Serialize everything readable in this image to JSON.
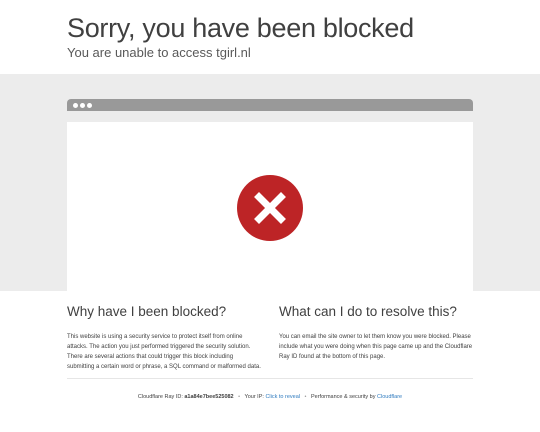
{
  "header": {
    "title": "Sorry, you have been blocked",
    "subtitle": "You are unable to access tgirl.nl"
  },
  "error_icon": {
    "name": "error-x-icon",
    "color": "#bd2426"
  },
  "sections": {
    "why": {
      "heading": "Why have I been blocked?",
      "body": "This website is using a security service to protect itself from online attacks. The action you just performed triggered the security solution. There are several actions that could trigger this block including submitting a certain word or phrase, a SQL command or malformed data."
    },
    "what": {
      "heading": "What can I do to resolve this?",
      "body": "You can email the site owner to let them know you were blocked. Please include what you were doing when this page came up and the Cloudflare Ray ID found at the bottom of this page."
    }
  },
  "footer": {
    "ray_label": "Cloudflare Ray ID:",
    "ray_id": "a1a84e7bee525082",
    "ip_label": "Your IP:",
    "ip_link": "Click to reveal",
    "perf_label": "Performance & security by",
    "perf_link": "Cloudflare",
    "separator": "•"
  },
  "colors": {
    "accent_link": "#2f7bbf",
    "error_red": "#bd2426",
    "browser_bar": "#999999",
    "band": "#ececec"
  }
}
